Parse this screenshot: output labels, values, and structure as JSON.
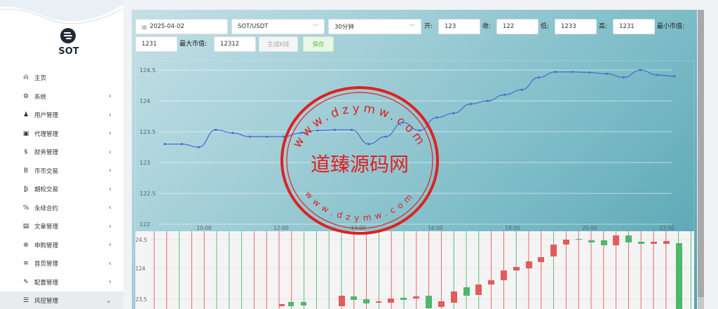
{
  "sidebar": {
    "brand": "SOT",
    "items": [
      {
        "label": "主页",
        "icon": "bar-chart-icon",
        "glyph": "ılı",
        "chevron": ""
      },
      {
        "label": "系统",
        "icon": "gear-icon",
        "glyph": "⚙",
        "chevron": "‹"
      },
      {
        "label": "用户管理",
        "icon": "user-icon",
        "glyph": "♟",
        "chevron": "‹"
      },
      {
        "label": "代理管理",
        "icon": "id-card-icon",
        "glyph": "▣",
        "chevron": "‹"
      },
      {
        "label": "财务管理",
        "icon": "dollar-icon",
        "glyph": "$",
        "chevron": "‹"
      },
      {
        "label": "币币交易",
        "icon": "bitcoin-icon",
        "glyph": "B",
        "chevron": "‹"
      },
      {
        "label": "期权交易",
        "icon": "bitcoin-small-icon",
        "glyph": "₿",
        "chevron": "‹"
      },
      {
        "label": "永续合约",
        "icon": "link-icon",
        "glyph": "%",
        "chevron": "‹"
      },
      {
        "label": "文章管理",
        "icon": "newspaper-icon",
        "glyph": "▤",
        "chevron": "‹"
      },
      {
        "label": "申购管理",
        "icon": "globe-icon",
        "glyph": "⊕",
        "chevron": "‹"
      },
      {
        "label": "首页管理",
        "icon": "list-icon",
        "glyph": "≡",
        "chevron": "‹"
      },
      {
        "label": "配置管理",
        "icon": "wrench-icon",
        "glyph": "✎",
        "chevron": "‹"
      },
      {
        "label": "风控管理",
        "icon": "sliders-icon",
        "glyph": "☰",
        "chevron": "⌄"
      }
    ]
  },
  "toolbar": {
    "date": "2025-04-02",
    "date_icon": "calendar-icon",
    "symbol": "SOT/USDT",
    "interval": "30分钟",
    "open_label": "开:",
    "open_value": "123",
    "close_label": "收:",
    "close_value": "122",
    "low_label": "低:",
    "low_value": "1233",
    "high_label": "高:",
    "high_value": "1231",
    "min_mcap_label": "最小市值:",
    "min_mcap_value": "1231",
    "max_mcap_label": "最大市值:",
    "max_mcap_value": "12312",
    "generate_label": "生成K线",
    "save_label": "保存"
  },
  "chart_data": [
    {
      "type": "line",
      "yticks": [
        "124.5",
        "124",
        "123.5",
        "123",
        "122.5",
        "122"
      ],
      "xticks": [
        "10:00",
        "12:00",
        "14:00",
        "16:00",
        "18:00",
        "20:00",
        "22:00"
      ],
      "ylim": [
        122,
        124.5
      ],
      "series": [
        {
          "values": [
            123.3,
            123.3,
            123.25,
            123.53,
            123.48,
            123.42,
            123.42,
            123.42,
            123.48,
            123.52,
            123.53,
            123.53,
            123.3,
            123.42,
            123.65,
            123.52,
            123.73,
            123.8,
            123.95,
            124,
            124.1,
            124.18,
            124.38,
            124.47,
            124.47,
            124.46,
            124.44,
            124.38,
            124.5,
            124.42,
            124.4
          ]
        }
      ],
      "color": "#4a6fd1"
    },
    {
      "type": "candlestick",
      "ytick_labels": [
        "24.5",
        "124",
        "23.5"
      ],
      "series": [
        {
          "name": "bull",
          "color": "#4cb86a"
        },
        {
          "name": "bear",
          "color": "#e35b5b"
        }
      ]
    }
  ],
  "watermark": {
    "top_text": "www.dzymw.com",
    "center_text": "道臻源码网",
    "bottom_text": "www.dzymw.com",
    "color": "#e02020"
  }
}
